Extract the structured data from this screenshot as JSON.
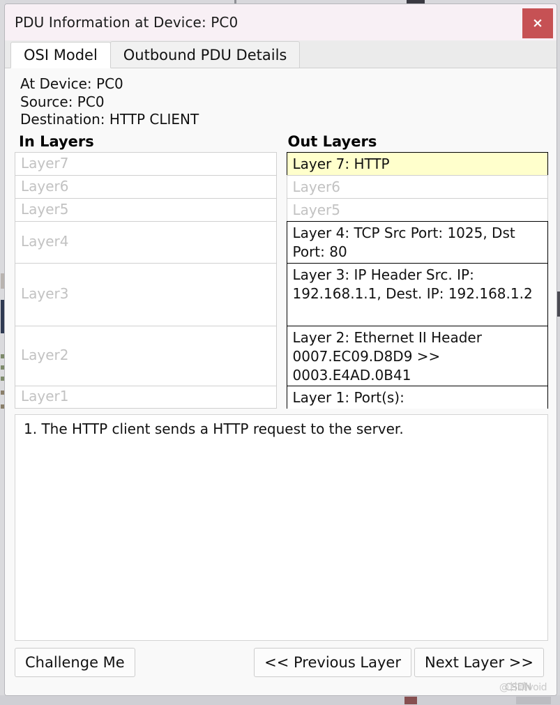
{
  "window": {
    "title": "PDU Information at Device: PC0",
    "close_label": "×",
    "close_icon": "close-icon",
    "accent_titlebar": "#f8f0f5",
    "accent_close": "#c65154",
    "highlight_color": "#ffffcc"
  },
  "tabs": [
    {
      "label": "OSI Model",
      "active": true
    },
    {
      "label": "Outbound PDU Details",
      "active": false
    }
  ],
  "meta": {
    "at_device": "At Device: PC0",
    "source": "Source: PC0",
    "destination": "Destination: HTTP CLIENT"
  },
  "in_layers": {
    "heading": "In Layers",
    "rows": [
      {
        "label": "Layer7",
        "state": "empty",
        "size": "small"
      },
      {
        "label": "Layer6",
        "state": "empty",
        "size": "small"
      },
      {
        "label": "Layer5",
        "state": "empty",
        "size": "small"
      },
      {
        "label": "Layer4",
        "state": "empty",
        "size": "medium"
      },
      {
        "label": "Layer3",
        "state": "empty",
        "size": "large"
      },
      {
        "label": "Layer2",
        "state": "empty",
        "size": "large"
      },
      {
        "label": "Layer1",
        "state": "empty",
        "size": "small"
      }
    ]
  },
  "out_layers": {
    "heading": "Out Layers",
    "rows": [
      {
        "label": "Layer 7: HTTP",
        "state": "highlight",
        "size": "small"
      },
      {
        "label": "Layer6",
        "state": "empty",
        "size": "small"
      },
      {
        "label": "Layer5",
        "state": "empty",
        "size": "small"
      },
      {
        "label": "Layer 4: TCP Src Port: 1025, Dst Port: 80",
        "state": "filled",
        "size": "medium"
      },
      {
        "label": "Layer 3: IP Header Src. IP: 192.168.1.1, Dest. IP: 192.168.1.2",
        "state": "filled",
        "size": "large"
      },
      {
        "label": "Layer 2: Ethernet II Header 0007.EC09.D8D9 >> 0003.E4AD.0B41",
        "state": "filled",
        "size": "large"
      },
      {
        "label": "Layer 1: Port(s):",
        "state": "filled",
        "size": "small"
      }
    ]
  },
  "description": {
    "text": "1. The HTTP client sends a HTTP request to the server."
  },
  "footer": {
    "challenge_label": "Challenge Me",
    "previous_label": "<< Previous Layer",
    "next_label": "Next Layer >>"
  },
  "watermark": {
    "source": "CSDN",
    "author": "@甘晴void"
  }
}
